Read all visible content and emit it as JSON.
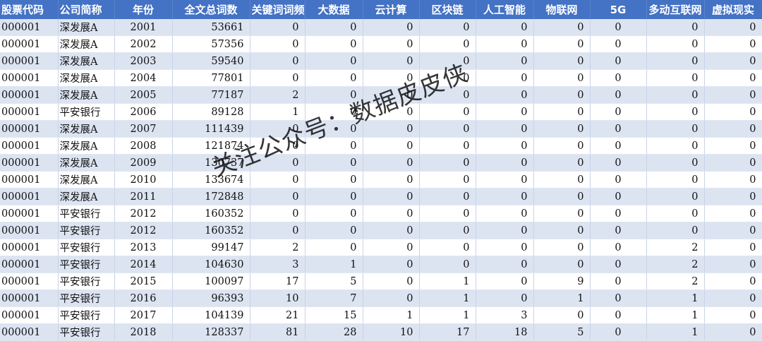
{
  "columns": [
    "股票代码",
    "公司简称",
    "年份",
    "全文总词数",
    "关键词词频",
    "大数据",
    "云计算",
    "区块链",
    "人工智能",
    "物联网",
    "5G",
    "多动互联网",
    "虚拟现实"
  ],
  "rows": [
    [
      "000001",
      "深发展A",
      "2001",
      "53661",
      "0",
      "0",
      "0",
      "0",
      "0",
      "0",
      "0",
      "0",
      "0"
    ],
    [
      "000001",
      "深发展A",
      "2002",
      "57356",
      "0",
      "0",
      "0",
      "0",
      "0",
      "0",
      "0",
      "0",
      "0"
    ],
    [
      "000001",
      "深发展A",
      "2003",
      "59540",
      "0",
      "0",
      "0",
      "0",
      "0",
      "0",
      "0",
      "0",
      "0"
    ],
    [
      "000001",
      "深发展A",
      "2004",
      "77801",
      "0",
      "0",
      "0",
      "0",
      "0",
      "0",
      "0",
      "0",
      "0"
    ],
    [
      "000001",
      "深发展A",
      "2005",
      "77187",
      "2",
      "0",
      "0",
      "0",
      "0",
      "0",
      "0",
      "0",
      "0"
    ],
    [
      "000001",
      "平安银行",
      "2006",
      "89128",
      "1",
      "0",
      "0",
      "0",
      "0",
      "0",
      "0",
      "0",
      "0"
    ],
    [
      "000001",
      "深发展A",
      "2007",
      "111439",
      "0",
      "0",
      "0",
      "0",
      "0",
      "0",
      "0",
      "0",
      "0"
    ],
    [
      "000001",
      "深发展A",
      "2008",
      "121874",
      "0",
      "0",
      "0",
      "0",
      "0",
      "0",
      "0",
      "0",
      "0"
    ],
    [
      "000001",
      "深发展A",
      "2009",
      "130737",
      "0",
      "0",
      "0",
      "0",
      "0",
      "0",
      "0",
      "0",
      "0"
    ],
    [
      "000001",
      "深发展A",
      "2010",
      "133674",
      "0",
      "0",
      "0",
      "0",
      "0",
      "0",
      "0",
      "0",
      "0"
    ],
    [
      "000001",
      "深发展A",
      "2011",
      "172848",
      "0",
      "0",
      "0",
      "0",
      "0",
      "0",
      "0",
      "0",
      "0"
    ],
    [
      "000001",
      "平安银行",
      "2012",
      "160352",
      "0",
      "0",
      "0",
      "0",
      "0",
      "0",
      "0",
      "0",
      "0"
    ],
    [
      "000001",
      "平安银行",
      "2012",
      "160352",
      "0",
      "0",
      "0",
      "0",
      "0",
      "0",
      "0",
      "0",
      "0"
    ],
    [
      "000001",
      "平安银行",
      "2013",
      "99147",
      "2",
      "0",
      "0",
      "0",
      "0",
      "0",
      "0",
      "2",
      "0"
    ],
    [
      "000001",
      "平安银行",
      "2014",
      "104630",
      "3",
      "1",
      "0",
      "0",
      "0",
      "0",
      "0",
      "2",
      "0"
    ],
    [
      "000001",
      "平安银行",
      "2015",
      "100097",
      "17",
      "5",
      "0",
      "1",
      "0",
      "9",
      "0",
      "2",
      "0"
    ],
    [
      "000001",
      "平安银行",
      "2016",
      "96393",
      "10",
      "7",
      "0",
      "1",
      "0",
      "1",
      "0",
      "1",
      "0"
    ],
    [
      "000001",
      "平安银行",
      "2017",
      "104139",
      "21",
      "15",
      "1",
      "1",
      "3",
      "0",
      "0",
      "1",
      "0"
    ],
    [
      "000001",
      "平安银行",
      "2018",
      "128337",
      "81",
      "28",
      "10",
      "17",
      "18",
      "5",
      "0",
      "1",
      "0"
    ]
  ],
  "watermark": "关注公众号：数据皮皮侠"
}
